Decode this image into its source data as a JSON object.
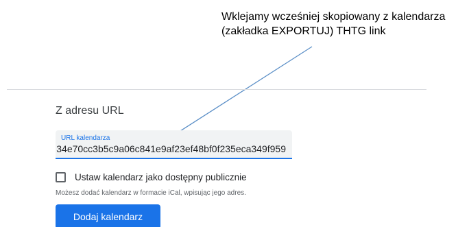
{
  "annotation": {
    "line1": "Wklejamy wcześniej skopiowany z kalendarza",
    "line2": "(zakładka EXPORTUJ) THTG link"
  },
  "section": {
    "title": "Z adresu URL"
  },
  "url_field": {
    "label": "URL kalendarza",
    "value": "34e70cc3b5c9a06c841e9af23ef48bf0f235eca349f959"
  },
  "checkbox": {
    "label": "Ustaw kalendarz jako dostępny publicznie",
    "checked": false
  },
  "helper": {
    "text": "Możesz dodać kalendarz w formacie iCal, wpisując jego adres."
  },
  "button": {
    "label": "Dodaj kalendarz"
  },
  "colors": {
    "accent": "#1a73e8",
    "field_bg": "#f1f3f4",
    "arrow": "#5b8fc7"
  }
}
